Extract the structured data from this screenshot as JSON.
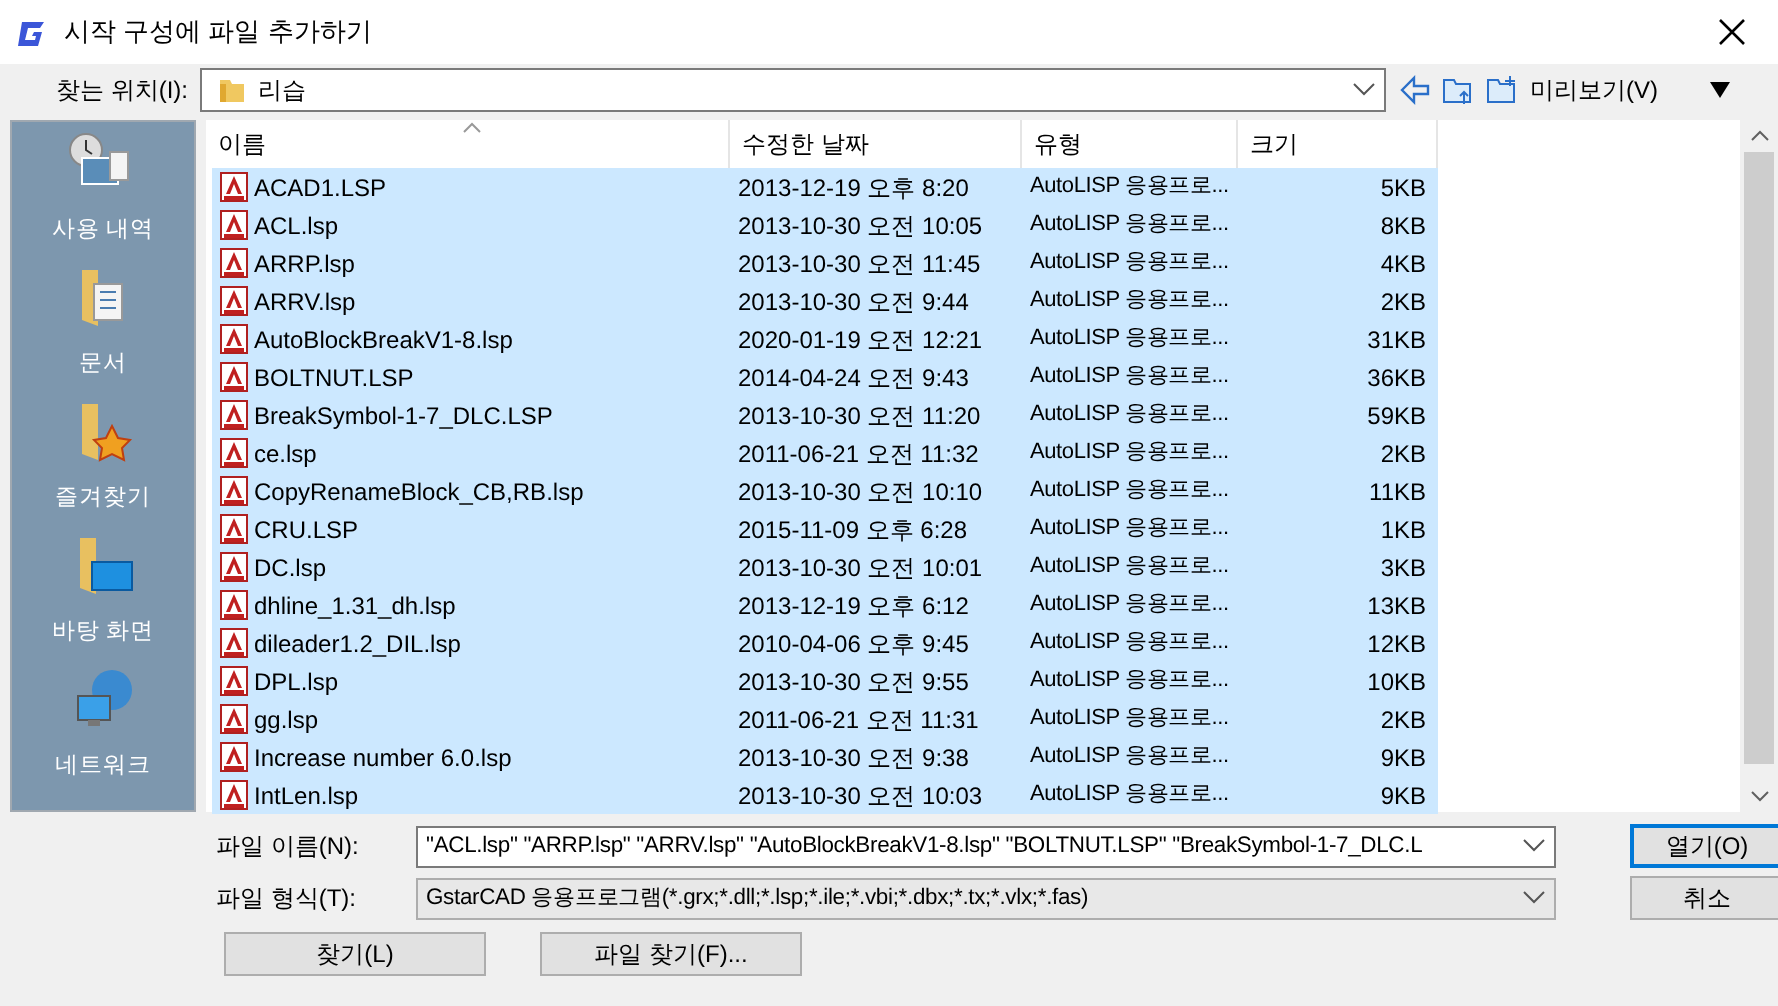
{
  "window": {
    "title": "시작 구성에 파일 추가하기"
  },
  "location": {
    "label": "찾는 위치(I):",
    "value": "리습",
    "preview_label": "미리보기(V)"
  },
  "sidebar": {
    "items": [
      {
        "label": "사용 내역",
        "kind": "recent"
      },
      {
        "label": "문서",
        "kind": "documents"
      },
      {
        "label": "즐겨찾기",
        "kind": "favorites"
      },
      {
        "label": "바탕 화면",
        "kind": "desktop"
      },
      {
        "label": "네트워크",
        "kind": "network"
      }
    ]
  },
  "table": {
    "columns": [
      {
        "label": "이름",
        "sorted": true
      },
      {
        "label": "수정한 날짜",
        "sorted": false
      },
      {
        "label": "유형",
        "sorted": false
      },
      {
        "label": "크기",
        "sorted": false
      }
    ],
    "rows": [
      {
        "name": "ACAD1.LSP",
        "date": "2013-12-19 오후 8:20",
        "type": "AutoLISP 응용프로...",
        "size": "5KB",
        "selected": true
      },
      {
        "name": "ACL.lsp",
        "date": "2013-10-30 오전 10:05",
        "type": "AutoLISP 응용프로...",
        "size": "8KB",
        "selected": true
      },
      {
        "name": "ARRP.lsp",
        "date": "2013-10-30 오전 11:45",
        "type": "AutoLISP 응용프로...",
        "size": "4KB",
        "selected": true
      },
      {
        "name": "ARRV.lsp",
        "date": "2013-10-30 오전 9:44",
        "type": "AutoLISP 응용프로...",
        "size": "2KB",
        "selected": true
      },
      {
        "name": "AutoBlockBreakV1-8.lsp",
        "date": "2020-01-19 오전 12:21",
        "type": "AutoLISP 응용프로...",
        "size": "31KB",
        "selected": true
      },
      {
        "name": "BOLTNUT.LSP",
        "date": "2014-04-24 오전 9:43",
        "type": "AutoLISP 응용프로...",
        "size": "36KB",
        "selected": true
      },
      {
        "name": "BreakSymbol-1-7_DLC.LSP",
        "date": "2013-10-30 오전 11:20",
        "type": "AutoLISP 응용프로...",
        "size": "59KB",
        "selected": true
      },
      {
        "name": "ce.lsp",
        "date": "2011-06-21 오전 11:32",
        "type": "AutoLISP 응용프로...",
        "size": "2KB",
        "selected": true
      },
      {
        "name": "CopyRenameBlock_CB,RB.lsp",
        "date": "2013-10-30 오전 10:10",
        "type": "AutoLISP 응용프로...",
        "size": "11KB",
        "selected": true
      },
      {
        "name": "CRU.LSP",
        "date": "2015-11-09 오후 6:28",
        "type": "AutoLISP 응용프로...",
        "size": "1KB",
        "selected": true
      },
      {
        "name": "DC.lsp",
        "date": "2013-10-30 오전 10:01",
        "type": "AutoLISP 응용프로...",
        "size": "3KB",
        "selected": true
      },
      {
        "name": "dhline_1.31_dh.lsp",
        "date": "2013-12-19 오후 6:12",
        "type": "AutoLISP 응용프로...",
        "size": "13KB",
        "selected": true
      },
      {
        "name": "dileader1.2_DIL.lsp",
        "date": "2010-04-06 오후 9:45",
        "type": "AutoLISP 응용프로...",
        "size": "12KB",
        "selected": true
      },
      {
        "name": "DPL.lsp",
        "date": "2013-10-30 오전 9:55",
        "type": "AutoLISP 응용프로...",
        "size": "10KB",
        "selected": true
      },
      {
        "name": "gg.lsp",
        "date": "2011-06-21 오전 11:31",
        "type": "AutoLISP 응용프로...",
        "size": "2KB",
        "selected": true
      },
      {
        "name": "Increase number 6.0.lsp",
        "date": "2013-10-30 오전 9:38",
        "type": "AutoLISP 응용프로...",
        "size": "9KB",
        "selected": true
      },
      {
        "name": "IntLen.lsp",
        "date": "2013-10-30 오전 10:03",
        "type": "AutoLISP 응용프로...",
        "size": "9KB",
        "selected": true
      }
    ]
  },
  "filename": {
    "label": "파일 이름(N):",
    "value": "\"ACL.lsp\" \"ARRP.lsp\" \"ARRV.lsp\" \"AutoBlockBreakV1-8.lsp\" \"BOLTNUT.LSP\" \"BreakSymbol-1-7_DLC.L"
  },
  "filetype": {
    "label": "파일 형식(T):",
    "value": "GstarCAD 응용프로그램(*.grx;*.dll;*.lsp;*.ile;*.vbi;*.dbx;*.tx;*.vlx;*.fas)"
  },
  "buttons": {
    "open": "열기(O)",
    "cancel": "취소",
    "find": "찾기(L)",
    "find_file": "파일 찾기(F)..."
  }
}
